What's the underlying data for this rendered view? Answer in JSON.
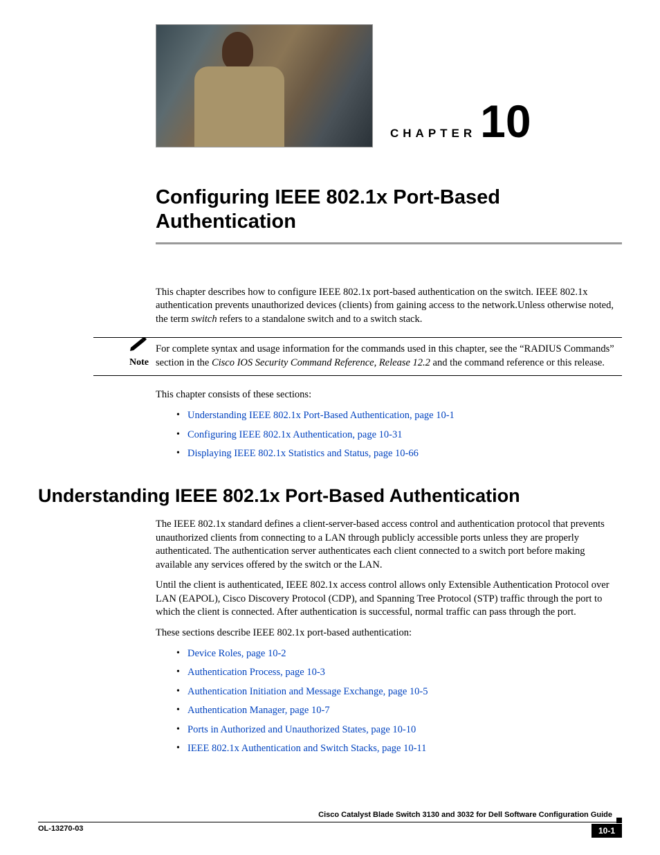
{
  "chapter": {
    "label": "CHAPTER",
    "number": "10",
    "title": "Configuring IEEE 802.1x Port-Based Authentication"
  },
  "intro": {
    "p1_a": "This chapter describes how to configure IEEE 802.1x port-based authentication on the switch. IEEE 802.1x authentication prevents unauthorized devices (clients) from gaining access to the network.Unless otherwise noted, the term ",
    "p1_switch": "switch",
    "p1_b": " refers to a standalone switch and to a switch stack."
  },
  "note": {
    "label": "Note",
    "text_a": "For complete syntax and usage information for the commands used in this chapter, see the “RADIUS Commands” section in the ",
    "text_i": "Cisco IOS Security Command Reference, Release 12.2",
    "text_b": " and the command reference or this release."
  },
  "consists": "This chapter consists of these sections:",
  "toc": [
    "Understanding IEEE 802.1x Port-Based Authentication, page 10-1",
    "Configuring IEEE 802.1x Authentication, page 10-31",
    "Displaying IEEE 802.1x Statistics and Status, page 10-66"
  ],
  "section": {
    "title": "Understanding IEEE 802.1x Port-Based Authentication",
    "p1": "The IEEE 802.1x standard defines a client-server-based access control and authentication protocol that prevents unauthorized clients from connecting to a LAN through publicly accessible ports unless they are properly authenticated. The authentication server authenticates each client connected to a switch port before making available any services offered by the switch or the LAN.",
    "p2": "Until the client is authenticated, IEEE 802.1x access control allows only Extensible Authentication Protocol over LAN (EAPOL), Cisco Discovery Protocol (CDP), and Spanning Tree Protocol (STP) traffic through the port to which the client is connected. After authentication is successful, normal traffic can pass through the port.",
    "p3": "These sections describe IEEE 802.1x port-based authentication:",
    "links": [
      "Device Roles, page 10-2",
      "Authentication Process, page 10-3",
      "Authentication Initiation and Message Exchange, page 10-5",
      "Authentication Manager, page 10-7",
      "Ports in Authorized and Unauthorized States, page 10-10",
      "IEEE 802.1x Authentication and Switch Stacks, page 10-11"
    ]
  },
  "footer": {
    "guide": "Cisco Catalyst Blade Switch 3130 and 3032 for Dell Software Configuration Guide",
    "doc_id": "OL-13270-03",
    "page": "10-1"
  }
}
